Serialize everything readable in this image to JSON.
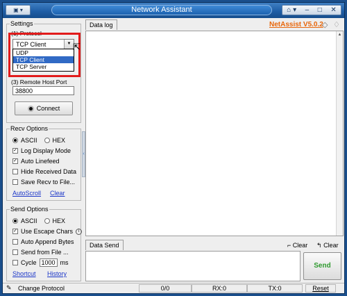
{
  "window": {
    "title": "Network Assistant",
    "sys_menu_glyph": "▣ ▾",
    "controls": [
      "⌂ ▾",
      "–",
      "□",
      "✕"
    ]
  },
  "version_link": "NetAssist V5.0.2",
  "settings": {
    "legend": "Settings",
    "protocol_label": "(1) Protocol",
    "protocol_selected": "TCP Client",
    "protocol_options": [
      "UDP",
      "TCP Client",
      "TCP Server"
    ],
    "remote_port_label": "(3) Remote Host Port",
    "remote_port_value": "38800",
    "connect_label": "Connect"
  },
  "recv_options": {
    "legend": "Recv Options",
    "ascii": "ASCII",
    "hex": "HEX",
    "log_display": "Log Display Mode",
    "auto_linefeed": "Auto Linefeed",
    "hide_received": "Hide Received Data",
    "save_recv": "Save Recv to File...",
    "autoscroll": "AutoScroll",
    "clear": "Clear"
  },
  "send_options": {
    "legend": "Send Options",
    "ascii": "ASCII",
    "hex": "HEX",
    "escape_chars": "Use Escape Chars",
    "auto_append": "Auto Append Bytes",
    "send_from_file": "Send from File ...",
    "cycle": "Cycle",
    "cycle_value": "1000",
    "cycle_unit": "ms",
    "shortcut": "Shortcut",
    "history": "History"
  },
  "data_log_tab": "Data log",
  "data_send_tab": "Data Send",
  "clear_left": "Clear",
  "clear_right": "Clear",
  "send_button": "Send",
  "status": {
    "hint": "Change Protocol",
    "count": "0/0",
    "rx": "RX:0",
    "tx": "TX:0",
    "reset": "Reset"
  },
  "colors": {
    "accent": "#e8660a",
    "link": "#1a35c8",
    "send_green": "#2f9a2f",
    "highlight": "#e21b1b"
  }
}
